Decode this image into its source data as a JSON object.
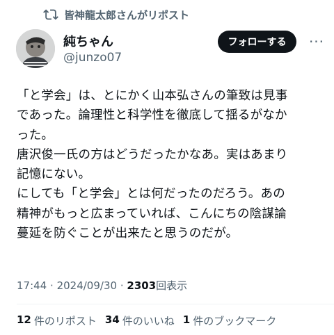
{
  "repost_header": {
    "text": "皆神龍太郎さんがリポスト"
  },
  "author": {
    "display_name": "純ちゃん",
    "handle": "@junzo07"
  },
  "follow_button": {
    "label": "フォローする"
  },
  "more_button": {
    "label": "···"
  },
  "tweet": {
    "lines": [
      "「と学会」は、とにかく山本弘さんの筆致は見事",
      "であった。論理性と科学性を徹底して揺るがなか",
      "った。",
      "唐沢俊一氏の方はどうだったかなあ。実はあまり",
      "記憶にない。",
      "にしても「と学会」とは何だったのだろう。あの",
      "精神がもっと広まっていれば、こんにちの陰謀論",
      "蔓延を防ぐことが出来たと思うのだが。"
    ]
  },
  "meta": {
    "time": "17:44",
    "separator": "·",
    "date": "2024/09/30",
    "views_count": "2303",
    "views_label": "回表示"
  },
  "stats": {
    "reposts": {
      "count": "12",
      "label": "件のリポスト"
    },
    "likes": {
      "count": "34",
      "label": "件のいいね"
    },
    "bookmarks": {
      "count": "1",
      "label": "件のブックマーク"
    }
  },
  "colors": {
    "text_primary": "#0f1419",
    "text_secondary": "#536471",
    "follow_button_bg": "#0f1419",
    "divider": "#eff3f4"
  }
}
